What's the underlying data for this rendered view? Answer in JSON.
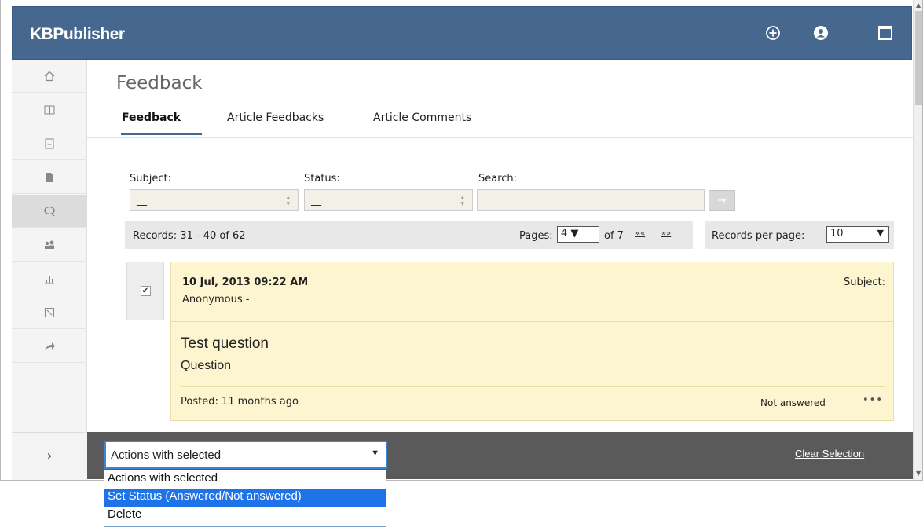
{
  "app": {
    "brand": "KBPublisher"
  },
  "topbar": {
    "icons": [
      "add-circle-icon",
      "user-circle-icon",
      "window-icon"
    ]
  },
  "sidebar": {
    "items": [
      "home-icon",
      "book-icon",
      "document-icon",
      "file-pdf-icon",
      "feedback-icon",
      "users-icon",
      "chart-icon",
      "report-icon",
      "share-icon"
    ],
    "active": "feedback-icon",
    "expand_label": "›"
  },
  "page": {
    "title": "Feedback",
    "tabs": [
      {
        "label": "Feedback",
        "active": true
      },
      {
        "label": "Article Feedbacks",
        "active": false
      },
      {
        "label": "Article Comments",
        "active": false
      }
    ]
  },
  "filters": {
    "subject_label": "Subject:",
    "subject_value": "__",
    "status_label": "Status:",
    "status_value": "__",
    "search_label": "Search:",
    "search_value": "",
    "go_label": "→"
  },
  "records": {
    "summary": "Records: 31 - 40 of 62",
    "pages_label": "Pages:",
    "current_page": "4 ▼",
    "of_pages": "of 7",
    "prev_label": "««",
    "next_label": "»»",
    "per_page_label": "Records per page:",
    "per_page_value": "10"
  },
  "item": {
    "checked": true,
    "date": "10 Jul, 2013 09:22 AM",
    "author": "Anonymous -",
    "subject_label": "Subject:",
    "title": "Test question",
    "body": "Question",
    "posted": "Posted: 11 months ago",
    "status": "Not answered",
    "more": "•••"
  },
  "actions": {
    "selected": "Actions with selected",
    "clear_label": "Clear Selection",
    "options": [
      "Actions with selected",
      "Set Status (Answered/Not answered)",
      "Delete"
    ],
    "highlighted_index": 1
  },
  "colors": {
    "topbar": "#46688f",
    "card": "#fcf5cf",
    "action_bar": "#5a5a5a",
    "highlight": "#1e73e8"
  }
}
